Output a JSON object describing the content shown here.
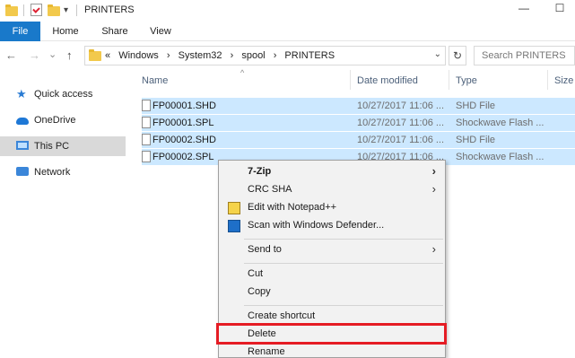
{
  "window": {
    "title": "PRINTERS",
    "controls": {
      "minimize": "—",
      "maximize": "☐"
    }
  },
  "ribbon": {
    "tabs": [
      "File",
      "Home",
      "Share",
      "View"
    ]
  },
  "address": {
    "back_glyph": "←",
    "forward_glyph": "→",
    "recent_glyph": "⌄",
    "up_glyph": "↑",
    "crumbs": [
      "«",
      "Windows",
      "›",
      "System32",
      "›",
      "spool",
      "›",
      "PRINTERS"
    ],
    "dropdown_glyph": "⌄",
    "refresh_glyph": "↻",
    "search_placeholder": "Search PRINTERS"
  },
  "nav": {
    "items": [
      {
        "label": "Quick access",
        "icon": "star-icon",
        "selected": false
      },
      {
        "label": "OneDrive",
        "icon": "cloud-icon",
        "selected": false
      },
      {
        "label": "This PC",
        "icon": "computer-icon",
        "selected": true
      },
      {
        "label": "Network",
        "icon": "network-icon",
        "selected": false
      }
    ]
  },
  "filelist": {
    "columns": [
      "Name",
      "Date modified",
      "Type",
      "Size"
    ],
    "sort_glyph": "^",
    "rows": [
      {
        "name": "FP00001.SHD",
        "date": "10/27/2017 11:06 ...",
        "type": "SHD File"
      },
      {
        "name": "FP00001.SPL",
        "date": "10/27/2017 11:06 ...",
        "type": "Shockwave Flash ..."
      },
      {
        "name": "FP00002.SHD",
        "date": "10/27/2017 11:06 ...",
        "type": "SHD File"
      },
      {
        "name": "FP00002.SPL",
        "date": "10/27/2017 11:06 ...",
        "type": "Shockwave Flash ..."
      }
    ]
  },
  "context_menu": {
    "items": [
      {
        "label": "7-Zip",
        "submenu": true
      },
      {
        "label": "CRC SHA",
        "submenu": true
      },
      {
        "label": "Edit with Notepad++",
        "submenu": false
      },
      {
        "label": "Scan with Windows Defender...",
        "submenu": false
      },
      {
        "label": "Send to",
        "submenu": true
      },
      {
        "label": "Cut",
        "submenu": false
      },
      {
        "label": "Copy",
        "submenu": false
      },
      {
        "label": "Create shortcut",
        "submenu": false
      },
      {
        "label": "Delete",
        "submenu": false
      },
      {
        "label": "Rename",
        "submenu": false
      }
    ],
    "submenu_glyph": "›",
    "highlight_color": "#e51c24"
  },
  "colors": {
    "accent": "#1979ca",
    "selection": "#cce8ff"
  }
}
